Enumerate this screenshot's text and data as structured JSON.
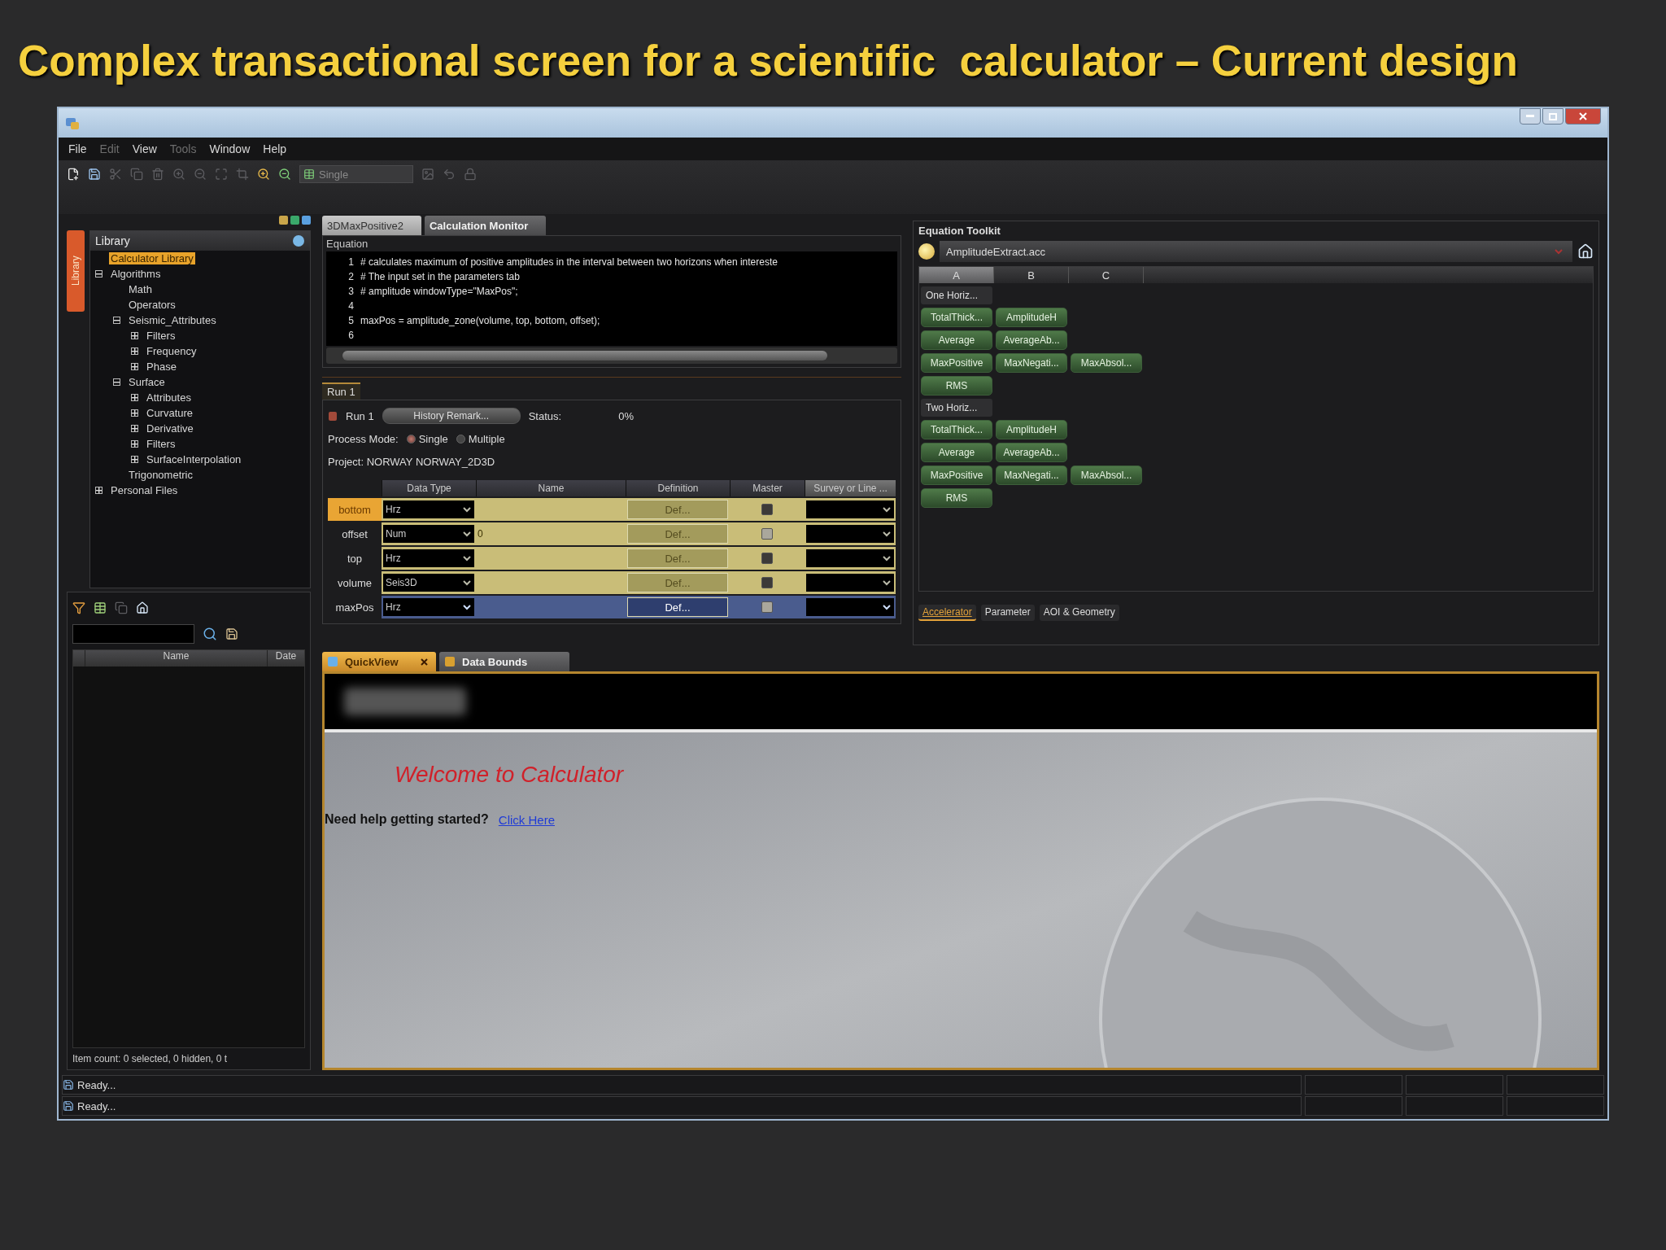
{
  "title": "Complex transactional screen for a scientific  calculator – Current design",
  "menu": [
    {
      "label": "File",
      "disabled": false
    },
    {
      "label": "Edit",
      "disabled": true
    },
    {
      "label": "View",
      "disabled": false
    },
    {
      "label": "Tools",
      "disabled": true
    },
    {
      "label": "Window",
      "disabled": false
    },
    {
      "label": "Help",
      "disabled": false
    }
  ],
  "toolbar": {
    "mode_select": "Single"
  },
  "library": {
    "side_tab": "Library",
    "title": "Library",
    "tree": [
      {
        "label": "Calculator Library",
        "selected": true
      },
      {
        "label": "Algorithms",
        "selected": false,
        "expanded": true,
        "children": [
          {
            "label": "Math",
            "selected": false
          },
          {
            "label": "Operators",
            "selected": false
          },
          {
            "label": "Seismic_Attributes",
            "selected": false,
            "expanded": true,
            "children": [
              {
                "label": "Filters",
                "selected": false,
                "expanded": false
              },
              {
                "label": "Frequency",
                "selected": false,
                "expanded": false
              },
              {
                "label": "Phase",
                "selected": false,
                "expanded": false
              }
            ]
          },
          {
            "label": "Surface",
            "selected": false,
            "expanded": true,
            "children": [
              {
                "label": "Attributes",
                "selected": false,
                "expanded": false
              },
              {
                "label": "Curvature",
                "selected": false,
                "expanded": false
              },
              {
                "label": "Derivative",
                "selected": false,
                "expanded": false
              },
              {
                "label": "Filters",
                "selected": false,
                "expanded": false
              },
              {
                "label": "SurfaceInterpolation",
                "selected": false,
                "expanded": false
              }
            ]
          },
          {
            "label": "Trigonometric",
            "selected": false
          }
        ]
      },
      {
        "label": "Personal Files",
        "selected": false,
        "expanded": false
      }
    ]
  },
  "file_browser": {
    "columns": [
      "Name",
      "Date"
    ],
    "footer": "Item count: 0 selected, 0 hidden, 0 t"
  },
  "doc_tabs": [
    {
      "label": "3DMaxPositive2",
      "selected": true
    },
    {
      "label": "Calculation Monitor",
      "selected": false
    }
  ],
  "equation": {
    "label": "Equation",
    "lines": [
      {
        "number": "1",
        "code": "# calculates maximum of positive amplitudes in the interval between two horizons when intereste"
      },
      {
        "number": "2",
        "code": "# The input set in the parameters tab"
      },
      {
        "number": "3",
        "code": "# amplitude windowType=\"MaxPos\";"
      },
      {
        "number": "4"
      },
      {
        "number": "5",
        "code": "maxPos = amplitude_zone(volume, top, bottom, offset);"
      },
      {
        "number": "6"
      }
    ]
  },
  "run": {
    "tab": "Run 1",
    "run_label": "Run 1",
    "history_button": "History Remark...",
    "status_label": "Status:",
    "status_value": "0%",
    "process_mode_label": "Process Mode:",
    "modes": [
      {
        "label": "Single",
        "selected": true
      },
      {
        "label": "Multiple",
        "selected": false
      }
    ],
    "project": "Project:  NORWAY NORWAY_2D3D",
    "table": {
      "columns": [
        "Data Type",
        "Name",
        "Definition",
        "Master",
        "Survey or Line ..."
      ],
      "rows": [
        {
          "label": "bottom",
          "selected": true,
          "kind": "input",
          "data_type": "Hrz",
          "definition": "Def...",
          "master_enabled": true
        },
        {
          "label": "offset",
          "selected": false,
          "kind": "input",
          "data_type": "Num",
          "name": "0",
          "definition": "Def...",
          "master_enabled": false
        },
        {
          "label": "top",
          "selected": false,
          "kind": "input",
          "data_type": "Hrz",
          "definition": "Def...",
          "master_enabled": true
        },
        {
          "label": "volume",
          "selected": false,
          "kind": "input",
          "data_type": "Seis3D",
          "definition": "Def...",
          "master_enabled": true
        },
        {
          "label": "maxPos",
          "selected": false,
          "kind": "output",
          "data_type": "Hrz",
          "definition": "Def...",
          "master_enabled": false
        }
      ]
    }
  },
  "toolkit": {
    "title": "Equation Toolkit",
    "file": "AmplitudeExtract.acc",
    "columns": [
      {
        "label": "A",
        "selected": true
      },
      {
        "label": "B",
        "selected": false
      },
      {
        "label": "C",
        "selected": false
      }
    ],
    "groups": [
      {
        "header": "One Horiz...",
        "rows": [
          [
            "TotalThick...",
            "AmplitudeH"
          ],
          [
            "Average",
            "AverageAb..."
          ],
          [
            "MaxPositive",
            "MaxNegati...",
            "MaxAbsol..."
          ],
          [
            "RMS"
          ]
        ]
      },
      {
        "header": "Two Horiz...",
        "rows": [
          [
            "TotalThick...",
            "AmplitudeH"
          ],
          [
            "Average",
            "AverageAb..."
          ],
          [
            "MaxPositive",
            "MaxNegati...",
            "MaxAbsol..."
          ],
          [
            "RMS"
          ]
        ]
      }
    ],
    "tabs": [
      {
        "label": "Accelerator",
        "selected": true
      },
      {
        "label": "Parameter",
        "selected": false
      },
      {
        "label": "AOI & Geometry",
        "selected": false
      }
    ]
  },
  "quickview": {
    "tabs": [
      {
        "label": "QuickView",
        "selected": true,
        "closable": true
      },
      {
        "label": "Data Bounds",
        "selected": false,
        "closable": false
      }
    ],
    "welcome": "Welcome to Calculator",
    "help": "Need help getting started?",
    "link": "Click Here"
  },
  "status_bars": [
    "Ready...",
    "Ready..."
  ]
}
